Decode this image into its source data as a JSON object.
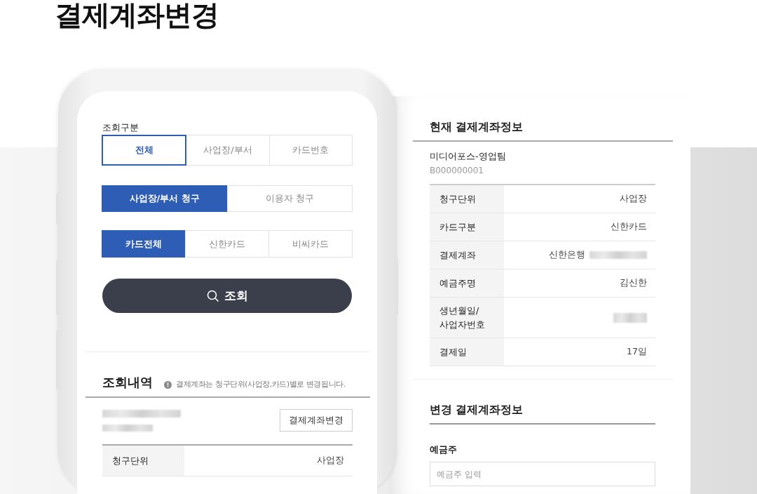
{
  "page_title": "결제계좌변경",
  "phone": {
    "filter_label": "조회구분",
    "segment_groups": [
      {
        "kind": "outline",
        "options": [
          {
            "label": "전체",
            "selected": true
          },
          {
            "label": "사업장/부서",
            "selected": false
          },
          {
            "label": "카드번호",
            "selected": false
          }
        ]
      },
      {
        "kind": "filled",
        "options": [
          {
            "label": "사업장/부서 청구",
            "selected": true
          },
          {
            "label": "이용자 청구",
            "selected": false
          }
        ]
      },
      {
        "kind": "filled",
        "options": [
          {
            "label": "카드전체",
            "selected": true
          },
          {
            "label": "신한카드",
            "selected": false
          },
          {
            "label": "비씨카드",
            "selected": false
          }
        ]
      }
    ],
    "search_button": "조회",
    "results_title": "조회내역",
    "notice": "결제계좌는 청구단위(사업장,카드)별로 변경됩니다.",
    "result": {
      "masked": true,
      "button": "결제계좌변경",
      "rows": [
        {
          "label": "청구단위",
          "value": "사업장"
        }
      ]
    }
  },
  "current_info": {
    "title": "현재 결제계좌정보",
    "name": "미디어포스-영업팀",
    "code": "B000000001",
    "rows": [
      {
        "label": "청구단위",
        "value": "사업장"
      },
      {
        "label": "카드구분",
        "value": "신한카드"
      },
      {
        "label": "결제계좌",
        "value": "신한은행",
        "masked": true
      },
      {
        "label": "예금주명",
        "value": "김신한"
      },
      {
        "label": "생년월일/\n사업자번호",
        "masked": true
      },
      {
        "label": "결제일",
        "value": "17일"
      }
    ]
  },
  "change_info": {
    "title": "변경 결제계좌정보",
    "fields": [
      {
        "label": "예금주",
        "placeholder": "예금주 입력"
      }
    ]
  }
}
